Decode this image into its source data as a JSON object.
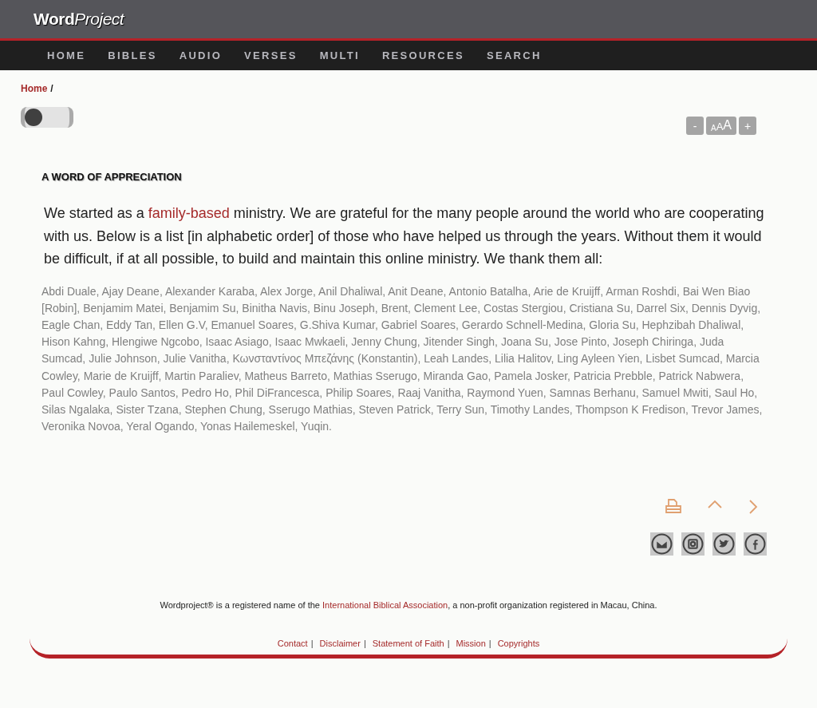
{
  "header": {
    "logo_bold": "Word",
    "logo_italic": "Project"
  },
  "nav": [
    "HOME",
    "BIBLES",
    "AUDIO",
    "VERSES",
    "MULTI",
    "RESOURCES",
    "SEARCH"
  ],
  "breadcrumb": {
    "link": "Home",
    "separator": "/"
  },
  "theme_toggle": {
    "on": false
  },
  "font_controls": {
    "decrease": "-",
    "sizes": "AAA",
    "increase": "+"
  },
  "heading": "A WORD OF APPRECIATION",
  "intro": {
    "before": "We started as a ",
    "link": "family-based",
    "after": " ministry. We are grateful for the many people around the world who are cooperating with us. Below is a list [in alphabetic order] of those who have helped us through the years. Without them it would be difficult, if at all possible, to build and maintain this online ministry. We thank them all:"
  },
  "names": "Abdi Duale, Ajay Deane, Alexander Karaba, Alex Jorge, Anil Dhaliwal, Anit Deane, Antonio Batalha, Arie de Kruijff, Arman Roshdi, Bai Wen Biao [Robin], Benjamim Matei, Benjamim Su, Binitha Navis, Binu Joseph, Brent, Clement Lee, Costas Stergiou, Cristiana Su, Darrel Six, Dennis Dyvig, Eagle Chan, Eddy Tan, Ellen G.V, Emanuel Soares, G.Shiva Kumar, Gabriel Soares, Gerardo Schnell-Medina, Gloria Su, Hephzibah Dhaliwal, Hison Kahng, Hlengiwe Ngcobo, Isaac Asiago, Isaac Mwkaeli, Jenny Chung, Jitender Singh, Joana Su, Jose Pinto, Joseph Chiringa, Juda Sumcad, Julie Johnson, Julie Vanitha, Κωνσταντίνος Μπεζάνης (Konstantin), Leah Landes, Lilia Halitov, Ling Ayleen Yien, Lisbet Sumcad, Marcia Cowley, Marie de Kruijff, Martin Paraliev, Matheus Barreto, Mathias Sserugo, Miranda Gao, Pamela Josker, Patricia Prebble, Patrick Nabwera, Paul Cowley, Paulo Santos, Pedro Ho, Phil DiFrancesca, Philip Soares, Raaj Vanitha, Raymond Yuen, Samnas Berhanu, Samuel Mwiti, Saul Ho, Silas Ngalaka, Sister Tzana, Stephen Chung, Sserugo Mathias, Steven Patrick, Terry Sun, Timothy Landes, Thompson K Fredison, Trevor James, Veronika Novoa, Yeral Ogando, Yonas Hailemeskel, Yuqin.",
  "page_tools": [
    {
      "kind": "print"
    },
    {
      "kind": "up"
    },
    {
      "kind": "next"
    }
  ],
  "social": [
    {
      "kind": "email"
    },
    {
      "kind": "instagram"
    },
    {
      "kind": "twitter"
    },
    {
      "kind": "facebook"
    }
  ],
  "footer": {
    "before": "Wordproject® is a registered name of the ",
    "link": "International Biblical Association",
    "after": ", a non-profit organization registered in Macau, China.",
    "links": [
      "Contact",
      "Disclaimer",
      "Statement of Faith",
      "Mission",
      "Copyrights"
    ],
    "separator": "|"
  }
}
